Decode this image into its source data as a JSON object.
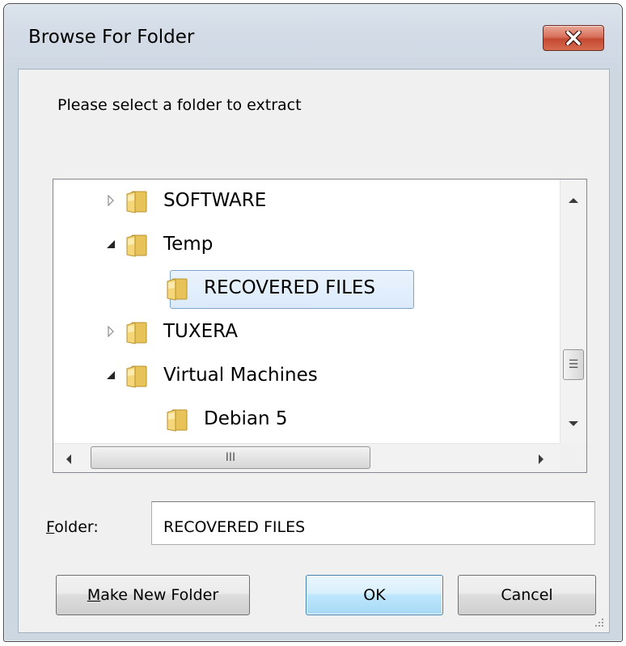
{
  "window": {
    "title": "Browse For Folder",
    "close_icon": "close-icon"
  },
  "prompt": "Please select a folder to extract",
  "tree": {
    "items": [
      {
        "label": "SOFTWARE",
        "expander": "collapsed",
        "level": 1,
        "selected": false
      },
      {
        "label": "Temp",
        "expander": "expanded",
        "level": 1,
        "selected": false
      },
      {
        "label": "RECOVERED FILES",
        "expander": "none",
        "level": 2,
        "selected": true
      },
      {
        "label": "TUXERA",
        "expander": "collapsed",
        "level": 1,
        "selected": false
      },
      {
        "label": "Virtual Machines",
        "expander": "expanded",
        "level": 1,
        "selected": false
      },
      {
        "label": "Debian 5",
        "expander": "none",
        "level": 2,
        "selected": false
      }
    ],
    "vscroll_grip": "☰",
    "hscroll_grip": "III"
  },
  "folder_field": {
    "label_mnemonic": "F",
    "label_rest": "older:",
    "value": "RECOVERED FILES"
  },
  "buttons": {
    "make_new_folder_mnemonic": "M",
    "make_new_folder_rest": "ake New Folder",
    "ok": "OK",
    "cancel": "Cancel"
  },
  "colors": {
    "selection_border": "#7da2ce",
    "selection_fill": "#dbeafb",
    "folder_yellow": "#f5d77a",
    "close_red": "#c44a31",
    "default_button_border": "#3c7fb1"
  }
}
